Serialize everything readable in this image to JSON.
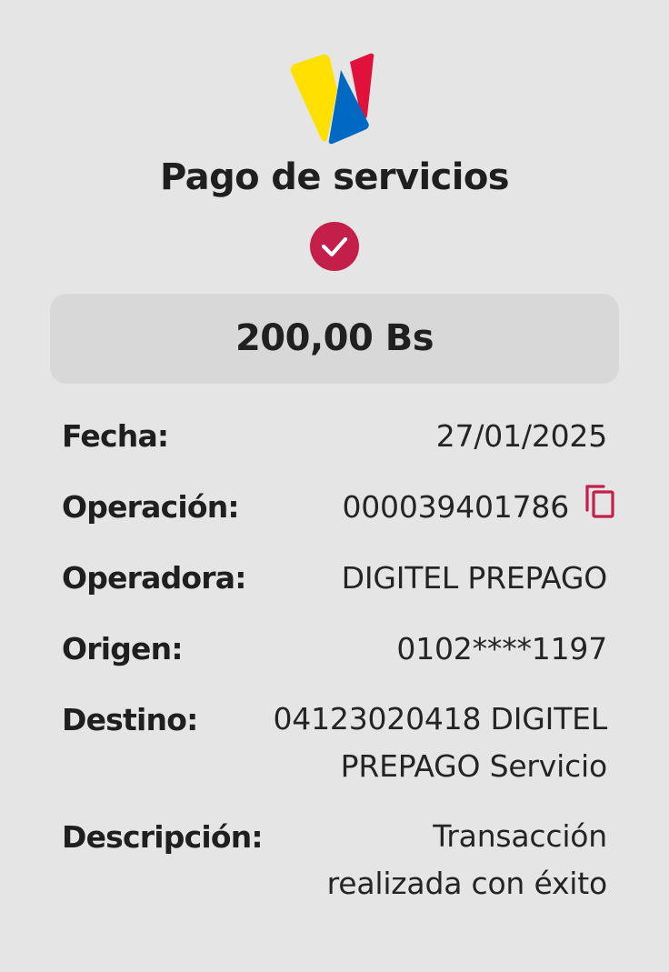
{
  "logo": {
    "icon": "banco-de-venezuela-logo-icon",
    "colors": {
      "yellow": "#ffe000",
      "blue": "#0069c4",
      "red": "#e0123c"
    }
  },
  "header": {
    "title": "Pago de servicios"
  },
  "status": {
    "icon": "check-circle-icon",
    "color": "#c41e4b"
  },
  "amount": {
    "value": "200,00 Bs"
  },
  "details": {
    "fecha": {
      "label": "Fecha:",
      "value": "27/01/2025"
    },
    "operacion": {
      "label": "Operación:",
      "value": "000039401786",
      "copy_icon": "copy-icon"
    },
    "operadora": {
      "label": "Operadora:",
      "value": "DIGITEL PREPAGO"
    },
    "origen": {
      "label": "Origen:",
      "value": "0102****1197"
    },
    "destino": {
      "label": "Destino:",
      "value_line1": "04123020418 DIGITEL",
      "value_line2": "PREPAGO Servicio"
    },
    "descripcion": {
      "label": "Descripción:",
      "value_line1": "Transacción",
      "value_line2": "realizada con éxito"
    }
  }
}
